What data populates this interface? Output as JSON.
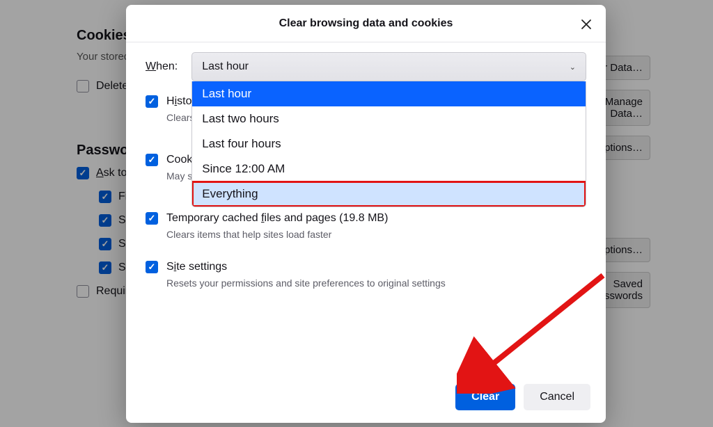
{
  "background": {
    "cookies_heading": "Cookies",
    "cookies_sub": "Your stored cookies, site data, and cache are using disk space.",
    "delete_label": "Delete cookies and site data when Firefox is closed",
    "passwords_heading": "Passwords",
    "ask_label": "Ask to save passwords",
    "c1": "Fill usernames and passwords automatically",
    "c2": "Suggest strong passwords",
    "c3": "Suggest Firefox Relay email masks",
    "c4": "Show alerts about passwords for breached websites",
    "req_label": "Require device sign in to fill and manage passwords",
    "btn_data": "Clear Data…",
    "btn_site": "Manage Data…",
    "btn_exc": "Exceptions…",
    "btn_s": "Exceptions…",
    "btn_pw": "Saved Passwords"
  },
  "dialog": {
    "title": "Clear browsing data and cookies",
    "when_label_pre": "W",
    "when_label_rest": "hen:",
    "selected": "Last hour",
    "options": [
      "Last hour",
      "Last two hours",
      "Last four hours",
      "Since 12:00 AM",
      "Everything"
    ],
    "items": {
      "history": {
        "label_pre": "H",
        "label_u": "i",
        "label_rest": "story",
        "desc": "Clears browsing history"
      },
      "cookies": {
        "label": "Cookies and site data",
        "desc": "May sign you out of websites"
      },
      "cache": {
        "label": "Temporary cached files and pages (19.8 MB)",
        "label_u": "f",
        "desc": "Clears items that help sites load faster"
      },
      "site": {
        "label": "Site settings",
        "label_u": "i",
        "desc": "Resets your permissions and site preferences to original settings"
      }
    },
    "clear": "Clear",
    "cancel": "Cancel"
  }
}
